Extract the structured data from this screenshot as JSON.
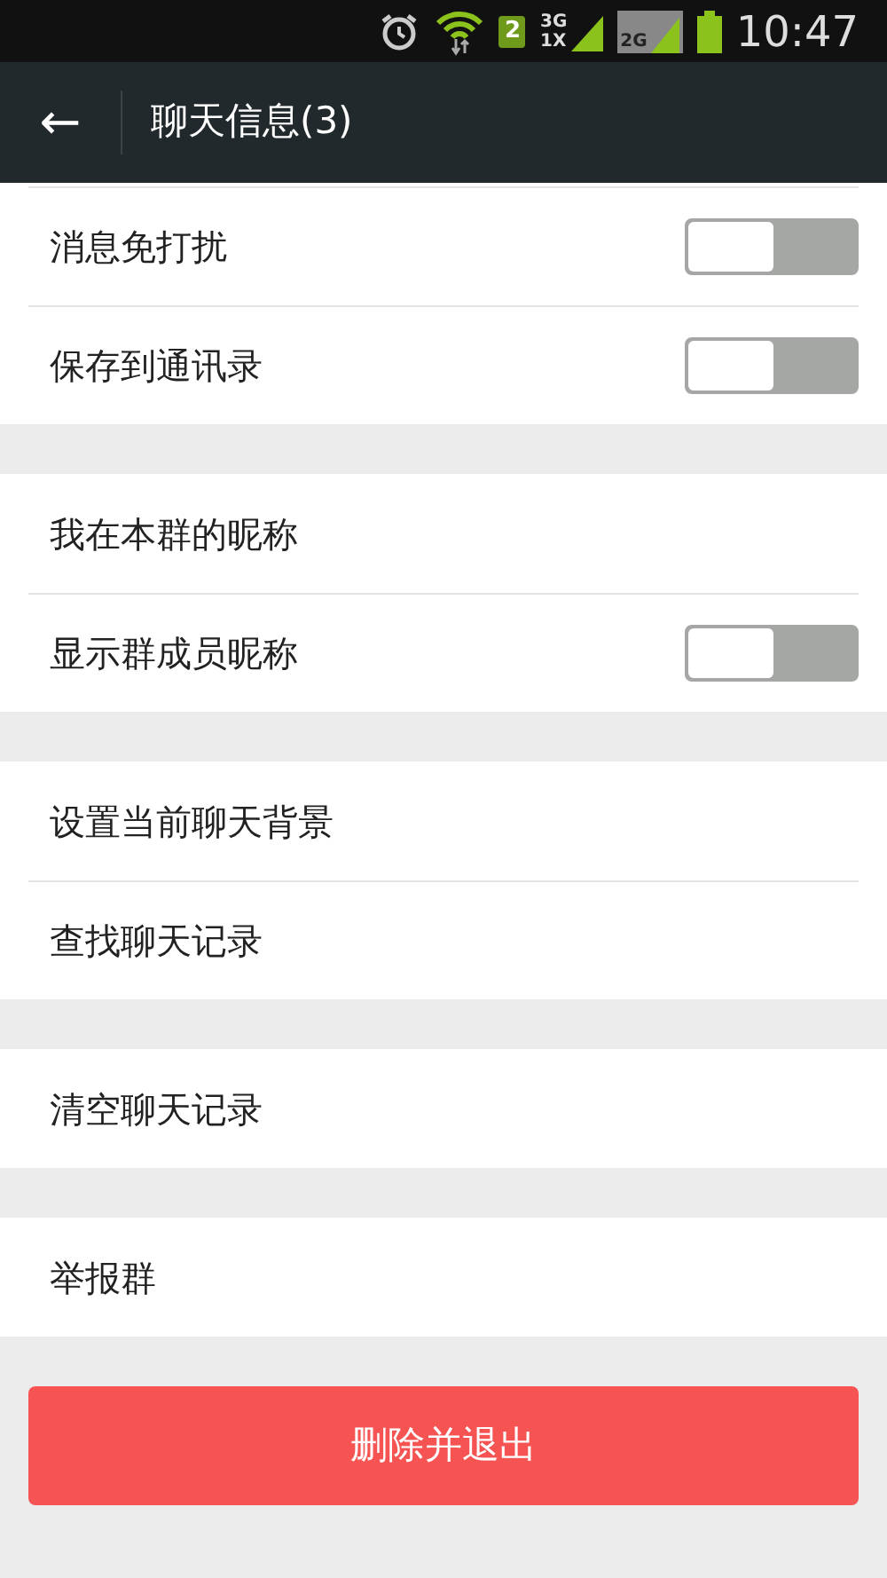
{
  "status_bar": {
    "sim": "2",
    "network_top": "3G",
    "network_bottom": "1X",
    "network_2": "2G",
    "time": "10:47"
  },
  "header": {
    "back": "←",
    "title": "聊天信息(3)"
  },
  "sections": [
    {
      "items": [
        {
          "kind": "toggle",
          "label": "消息免打扰",
          "on": false
        },
        {
          "kind": "toggle",
          "label": "保存到通讯录",
          "on": false
        }
      ]
    },
    {
      "items": [
        {
          "kind": "plain",
          "label": "我在本群的昵称"
        },
        {
          "kind": "toggle",
          "label": "显示群成员昵称",
          "on": false
        }
      ]
    },
    {
      "items": [
        {
          "kind": "plain",
          "label": "设置当前聊天背景"
        },
        {
          "kind": "plain",
          "label": "查找聊天记录"
        }
      ]
    },
    {
      "items": [
        {
          "kind": "plain",
          "label": "清空聊天记录"
        }
      ]
    },
    {
      "items": [
        {
          "kind": "plain",
          "label": "举报群"
        }
      ]
    }
  ],
  "delete_button": "删除并退出"
}
